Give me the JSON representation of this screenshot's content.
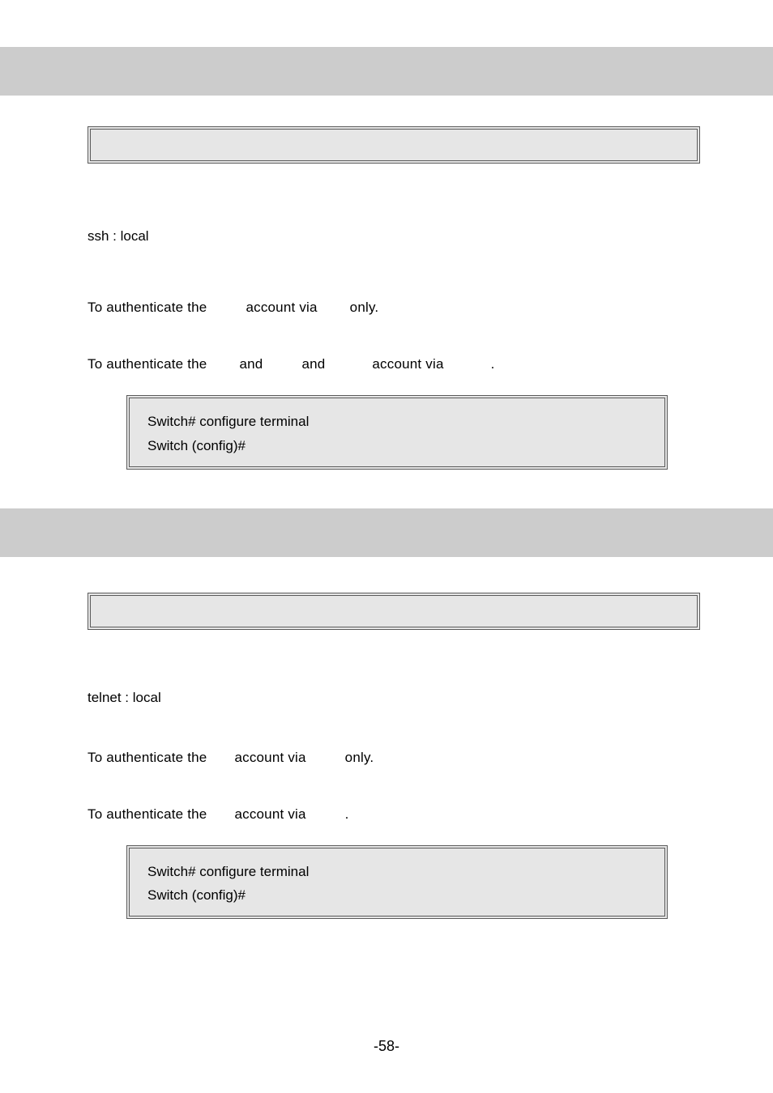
{
  "section1": {
    "default": "ssh : local",
    "line1_a": "To authenticate the",
    "line1_b": "account via",
    "line1_c": "only.",
    "line2_a": "To authenticate the",
    "line2_b": "and",
    "line2_c": "and",
    "line2_d": "account via",
    "line2_e": ".",
    "example_l1": "Switch# configure terminal",
    "example_l2": "Switch (config)#"
  },
  "section2": {
    "default": "telnet : local",
    "line1_a": "To authenticate the",
    "line1_b": "account via",
    "line1_c": "only.",
    "line2_a": "To authenticate the",
    "line2_b": "account via",
    "line2_c": ".",
    "example_l1": "Switch# configure terminal",
    "example_l2": "Switch (config)#"
  },
  "page_number": "-58-"
}
